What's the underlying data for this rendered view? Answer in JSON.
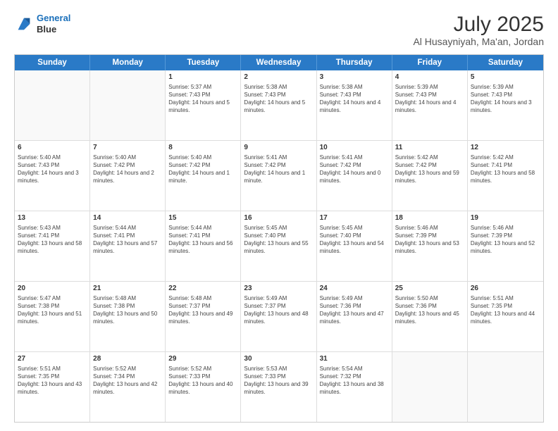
{
  "header": {
    "logo_line1": "General",
    "logo_line2": "Blue",
    "title": "July 2025",
    "subtitle": "Al Husayniyah, Ma'an, Jordan"
  },
  "days_of_week": [
    "Sunday",
    "Monday",
    "Tuesday",
    "Wednesday",
    "Thursday",
    "Friday",
    "Saturday"
  ],
  "weeks": [
    [
      {
        "day": "",
        "empty": true
      },
      {
        "day": "",
        "empty": true
      },
      {
        "day": "1",
        "sunrise": "Sunrise: 5:37 AM",
        "sunset": "Sunset: 7:43 PM",
        "daylight": "Daylight: 14 hours and 5 minutes."
      },
      {
        "day": "2",
        "sunrise": "Sunrise: 5:38 AM",
        "sunset": "Sunset: 7:43 PM",
        "daylight": "Daylight: 14 hours and 5 minutes."
      },
      {
        "day": "3",
        "sunrise": "Sunrise: 5:38 AM",
        "sunset": "Sunset: 7:43 PM",
        "daylight": "Daylight: 14 hours and 4 minutes."
      },
      {
        "day": "4",
        "sunrise": "Sunrise: 5:39 AM",
        "sunset": "Sunset: 7:43 PM",
        "daylight": "Daylight: 14 hours and 4 minutes."
      },
      {
        "day": "5",
        "sunrise": "Sunrise: 5:39 AM",
        "sunset": "Sunset: 7:43 PM",
        "daylight": "Daylight: 14 hours and 3 minutes."
      }
    ],
    [
      {
        "day": "6",
        "sunrise": "Sunrise: 5:40 AM",
        "sunset": "Sunset: 7:43 PM",
        "daylight": "Daylight: 14 hours and 3 minutes."
      },
      {
        "day": "7",
        "sunrise": "Sunrise: 5:40 AM",
        "sunset": "Sunset: 7:42 PM",
        "daylight": "Daylight: 14 hours and 2 minutes."
      },
      {
        "day": "8",
        "sunrise": "Sunrise: 5:40 AM",
        "sunset": "Sunset: 7:42 PM",
        "daylight": "Daylight: 14 hours and 1 minute."
      },
      {
        "day": "9",
        "sunrise": "Sunrise: 5:41 AM",
        "sunset": "Sunset: 7:42 PM",
        "daylight": "Daylight: 14 hours and 1 minute."
      },
      {
        "day": "10",
        "sunrise": "Sunrise: 5:41 AM",
        "sunset": "Sunset: 7:42 PM",
        "daylight": "Daylight: 14 hours and 0 minutes."
      },
      {
        "day": "11",
        "sunrise": "Sunrise: 5:42 AM",
        "sunset": "Sunset: 7:42 PM",
        "daylight": "Daylight: 13 hours and 59 minutes."
      },
      {
        "day": "12",
        "sunrise": "Sunrise: 5:42 AM",
        "sunset": "Sunset: 7:41 PM",
        "daylight": "Daylight: 13 hours and 58 minutes."
      }
    ],
    [
      {
        "day": "13",
        "sunrise": "Sunrise: 5:43 AM",
        "sunset": "Sunset: 7:41 PM",
        "daylight": "Daylight: 13 hours and 58 minutes."
      },
      {
        "day": "14",
        "sunrise": "Sunrise: 5:44 AM",
        "sunset": "Sunset: 7:41 PM",
        "daylight": "Daylight: 13 hours and 57 minutes."
      },
      {
        "day": "15",
        "sunrise": "Sunrise: 5:44 AM",
        "sunset": "Sunset: 7:41 PM",
        "daylight": "Daylight: 13 hours and 56 minutes."
      },
      {
        "day": "16",
        "sunrise": "Sunrise: 5:45 AM",
        "sunset": "Sunset: 7:40 PM",
        "daylight": "Daylight: 13 hours and 55 minutes."
      },
      {
        "day": "17",
        "sunrise": "Sunrise: 5:45 AM",
        "sunset": "Sunset: 7:40 PM",
        "daylight": "Daylight: 13 hours and 54 minutes."
      },
      {
        "day": "18",
        "sunrise": "Sunrise: 5:46 AM",
        "sunset": "Sunset: 7:39 PM",
        "daylight": "Daylight: 13 hours and 53 minutes."
      },
      {
        "day": "19",
        "sunrise": "Sunrise: 5:46 AM",
        "sunset": "Sunset: 7:39 PM",
        "daylight": "Daylight: 13 hours and 52 minutes."
      }
    ],
    [
      {
        "day": "20",
        "sunrise": "Sunrise: 5:47 AM",
        "sunset": "Sunset: 7:38 PM",
        "daylight": "Daylight: 13 hours and 51 minutes."
      },
      {
        "day": "21",
        "sunrise": "Sunrise: 5:48 AM",
        "sunset": "Sunset: 7:38 PM",
        "daylight": "Daylight: 13 hours and 50 minutes."
      },
      {
        "day": "22",
        "sunrise": "Sunrise: 5:48 AM",
        "sunset": "Sunset: 7:37 PM",
        "daylight": "Daylight: 13 hours and 49 minutes."
      },
      {
        "day": "23",
        "sunrise": "Sunrise: 5:49 AM",
        "sunset": "Sunset: 7:37 PM",
        "daylight": "Daylight: 13 hours and 48 minutes."
      },
      {
        "day": "24",
        "sunrise": "Sunrise: 5:49 AM",
        "sunset": "Sunset: 7:36 PM",
        "daylight": "Daylight: 13 hours and 47 minutes."
      },
      {
        "day": "25",
        "sunrise": "Sunrise: 5:50 AM",
        "sunset": "Sunset: 7:36 PM",
        "daylight": "Daylight: 13 hours and 45 minutes."
      },
      {
        "day": "26",
        "sunrise": "Sunrise: 5:51 AM",
        "sunset": "Sunset: 7:35 PM",
        "daylight": "Daylight: 13 hours and 44 minutes."
      }
    ],
    [
      {
        "day": "27",
        "sunrise": "Sunrise: 5:51 AM",
        "sunset": "Sunset: 7:35 PM",
        "daylight": "Daylight: 13 hours and 43 minutes."
      },
      {
        "day": "28",
        "sunrise": "Sunrise: 5:52 AM",
        "sunset": "Sunset: 7:34 PM",
        "daylight": "Daylight: 13 hours and 42 minutes."
      },
      {
        "day": "29",
        "sunrise": "Sunrise: 5:52 AM",
        "sunset": "Sunset: 7:33 PM",
        "daylight": "Daylight: 13 hours and 40 minutes."
      },
      {
        "day": "30",
        "sunrise": "Sunrise: 5:53 AM",
        "sunset": "Sunset: 7:33 PM",
        "daylight": "Daylight: 13 hours and 39 minutes."
      },
      {
        "day": "31",
        "sunrise": "Sunrise: 5:54 AM",
        "sunset": "Sunset: 7:32 PM",
        "daylight": "Daylight: 13 hours and 38 minutes."
      },
      {
        "day": "",
        "empty": true
      },
      {
        "day": "",
        "empty": true
      }
    ]
  ]
}
